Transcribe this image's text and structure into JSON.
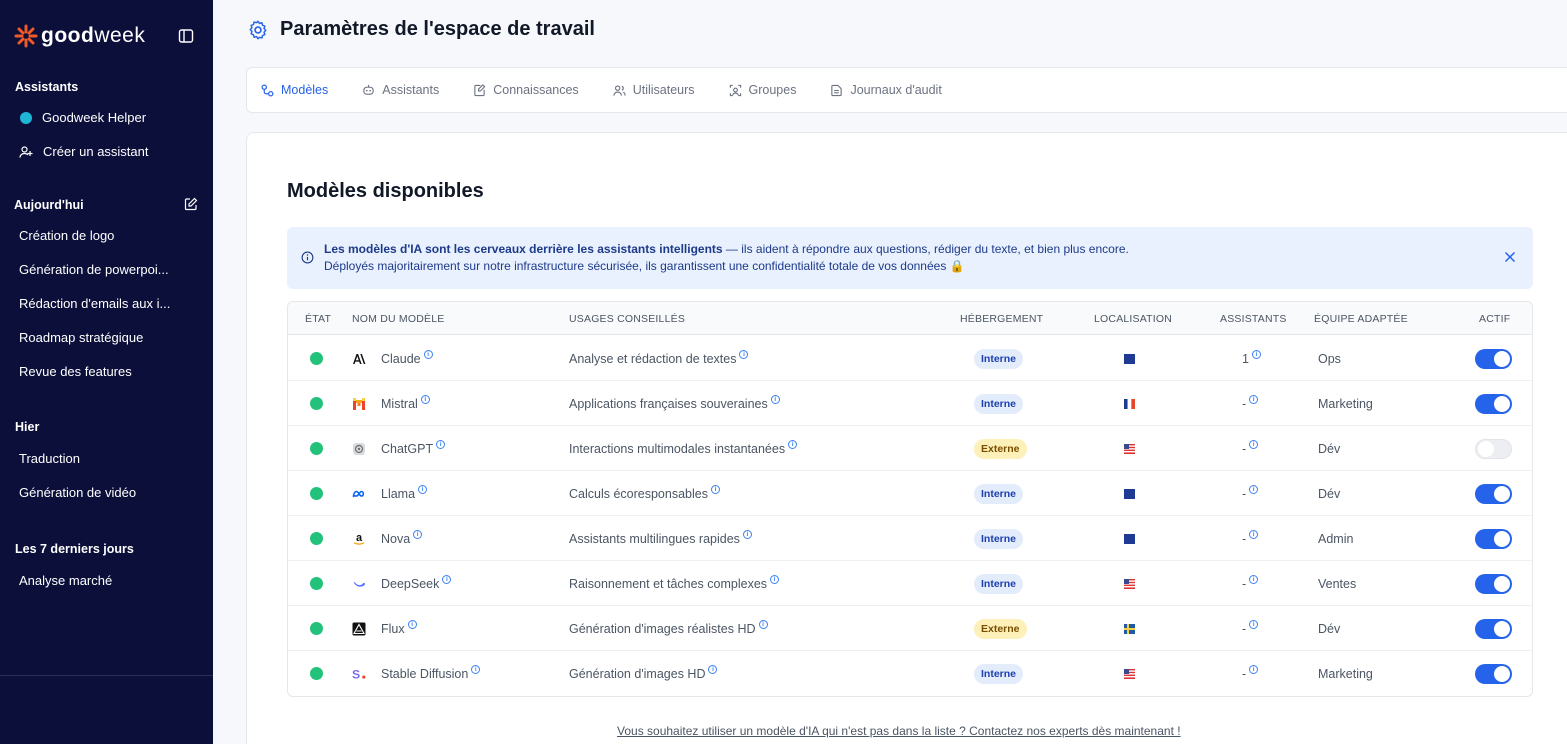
{
  "app": {
    "brand_bold": "good",
    "brand_light": "week"
  },
  "sidebar": {
    "assistants_title": "Assistants",
    "assistants": [
      {
        "label": "Goodweek Helper"
      },
      {
        "label": "Créer un assistant"
      }
    ],
    "today_title": "Aujourd'hui",
    "today": [
      {
        "label": "Création de logo"
      },
      {
        "label": "Génération de powerpoi..."
      },
      {
        "label": "Rédaction d'emails aux i..."
      },
      {
        "label": "Roadmap stratégique"
      },
      {
        "label": "Revue des features"
      }
    ],
    "yesterday_title": "Hier",
    "yesterday": [
      {
        "label": "Traduction"
      },
      {
        "label": "Génération de vidéo"
      }
    ],
    "last7_title": "Les 7 derniers jours",
    "last7": [
      {
        "label": "Analyse marché"
      }
    ]
  },
  "header": {
    "title": "Paramètres de l'espace de travail"
  },
  "tabs": [
    {
      "label": "Modèles",
      "icon": "models-icon",
      "active": true
    },
    {
      "label": "Assistants",
      "icon": "assistant-icon",
      "active": false
    },
    {
      "label": "Connaissances",
      "icon": "knowledge-icon",
      "active": false
    },
    {
      "label": "Utilisateurs",
      "icon": "users-icon",
      "active": false
    },
    {
      "label": "Groupes",
      "icon": "groups-icon",
      "active": false
    },
    {
      "label": "Journaux d'audit",
      "icon": "audit-icon",
      "active": false
    }
  ],
  "main": {
    "section_title": "Modèles disponibles",
    "info": {
      "bold": "Les modèles d'IA sont les cerveaux derrière les assistants intelligents",
      "rest": " — ils aident à répondre aux questions, rédiger du texte, et bien plus encore.",
      "line2": "Déployés majoritairement sur notre infrastructure sécurisée, ils garantissent une confidentialité totale de vos données 🔒"
    },
    "columns": {
      "state": "ÉTAT",
      "name": "NOM DU MODÈLE",
      "usage": "USAGES CONSEILLÉS",
      "hosting": "HÉBERGEMENT",
      "location": "LOCALISATION",
      "assistants": "ASSISTANTS",
      "team": "ÉQUIPE ADAPTÉE",
      "active": "ACTIF"
    },
    "rows": [
      {
        "name": "Claude",
        "usage": "Analyse et rédaction de textes",
        "hosting": "Interne",
        "flag": "eu",
        "assistants": "1",
        "team": "Ops",
        "active": true
      },
      {
        "name": "Mistral",
        "usage": "Applications françaises souveraines",
        "hosting": "Interne",
        "flag": "fr",
        "assistants": "-",
        "team": "Marketing",
        "active": true
      },
      {
        "name": "ChatGPT",
        "usage": "Interactions multimodales instantanées",
        "hosting": "Externe",
        "flag": "us",
        "assistants": "-",
        "team": "Dév",
        "active": false
      },
      {
        "name": "Llama",
        "usage": "Calculs écoresponsables",
        "hosting": "Interne",
        "flag": "eu",
        "assistants": "-",
        "team": "Dév",
        "active": true
      },
      {
        "name": "Nova",
        "usage": "Assistants multilingues rapides",
        "hosting": "Interne",
        "flag": "eu",
        "assistants": "-",
        "team": "Admin",
        "active": true
      },
      {
        "name": "DeepSeek",
        "usage": "Raisonnement et tâches complexes",
        "hosting": "Interne",
        "flag": "us",
        "assistants": "-",
        "team": "Ventes",
        "active": true
      },
      {
        "name": "Flux",
        "usage": "Génération d'images réalistes HD",
        "hosting": "Externe",
        "flag": "se",
        "assistants": "-",
        "team": "Dév",
        "active": true
      },
      {
        "name": "Stable Diffusion",
        "usage": "Génération d'images HD",
        "hosting": "Interne",
        "flag": "us",
        "assistants": "-",
        "team": "Marketing",
        "active": true
      }
    ],
    "footer_link": "Vous souhaitez utiliser un modèle d'IA qui n'est pas dans la liste ? Contactez nos experts dès maintenant !"
  },
  "colors": {
    "sidebar_bg": "#0b0f3a",
    "accent": "#2563eb",
    "status_green": "#22c27a",
    "brand_orange": "#f05a28"
  }
}
